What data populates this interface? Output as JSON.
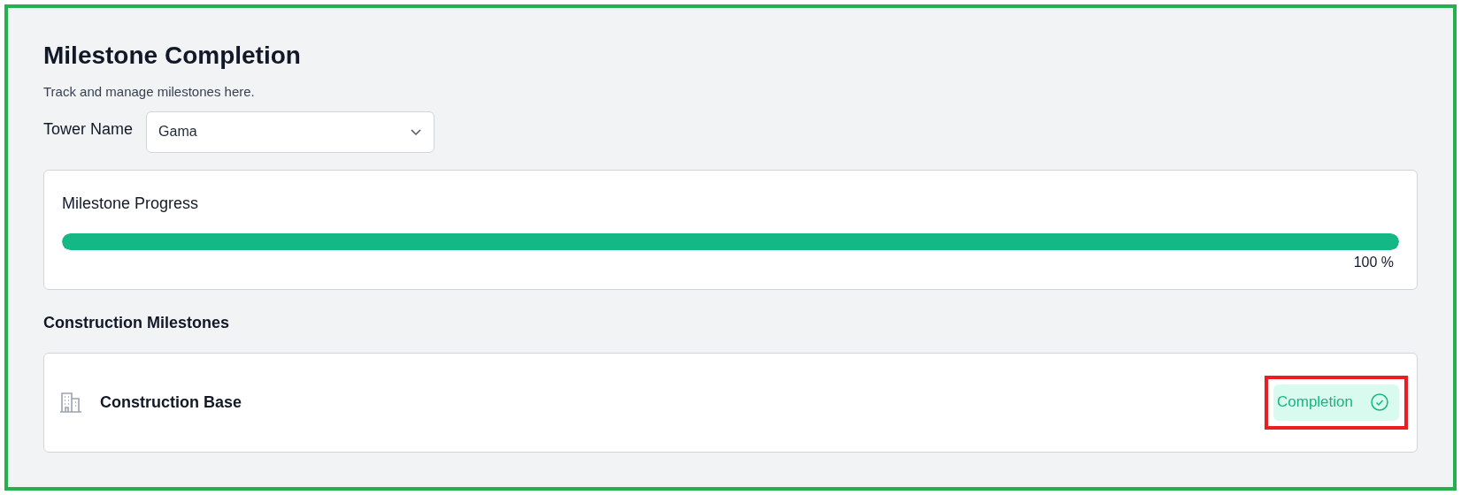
{
  "title": "Milestone Completion",
  "subtitle": "Track and manage milestones here.",
  "tower": {
    "label": "Tower Name",
    "value": "Gama"
  },
  "progress": {
    "title": "Milestone Progress",
    "level": 1,
    "reading": "100 %"
  },
  "section_title": "Construction Milestones",
  "milestones": [
    {
      "name": "Construction Base",
      "status": "Completion",
      "kind": "complete",
      "highlighted": true
    }
  ]
}
